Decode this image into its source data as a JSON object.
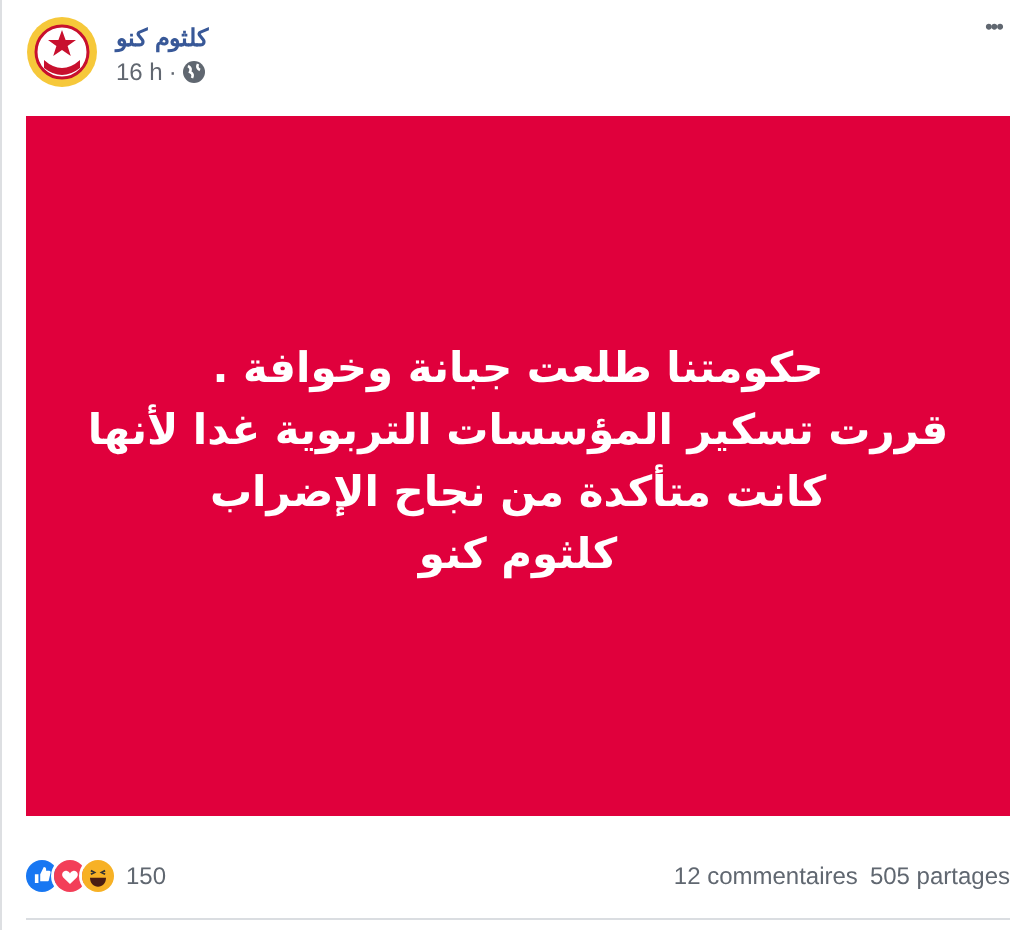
{
  "post": {
    "author": "كلثوم كنو",
    "time": "16 h",
    "separator": "·",
    "menu": "•••",
    "message_lines": [
      "حكومتنا طلعت جبانة وخوافة .",
      "قررت تسكير المؤسسات التربوية غدا لأنها",
      "كانت متأكدة من نجاح الإضراب",
      "كلثوم كنو"
    ],
    "reactions": [
      {
        "kind": "like"
      },
      {
        "kind": "love"
      },
      {
        "kind": "haha"
      }
    ],
    "reaction_count": "150",
    "comments": "12 commentaires",
    "shares": "505 partages"
  }
}
